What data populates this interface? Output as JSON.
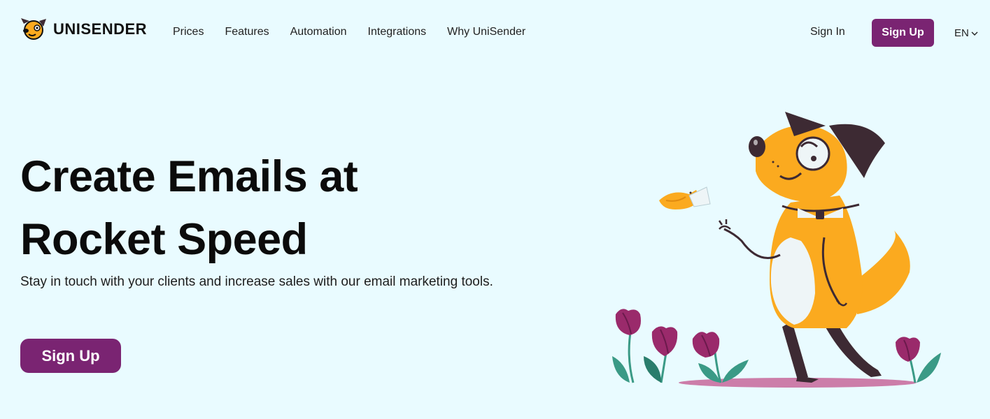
{
  "brand": {
    "name": "UNISENDER"
  },
  "nav": {
    "items": [
      {
        "label": "Prices"
      },
      {
        "label": "Features"
      },
      {
        "label": "Automation"
      },
      {
        "label": "Integrations"
      },
      {
        "label": "Why UniSender"
      }
    ]
  },
  "header": {
    "signin_label": "Sign In",
    "signup_label": "Sign Up",
    "language": "EN"
  },
  "hero": {
    "title_line1": "Create Emails at",
    "title_line2": "Rocket Speed",
    "subtitle": "Stay in touch with your clients and increase sales with our email marketing tools.",
    "cta_label": "Sign Up"
  },
  "colors": {
    "background": "#e9fbff",
    "accent": "#7a2472",
    "dog_orange": "#fbaa1f",
    "dark": "#3d2a33",
    "tulip": "#9a2a6b",
    "leaf": "#3a9a86"
  },
  "icons": {
    "logo": "dog-head-icon",
    "language_chevron": "chevron-down-icon"
  }
}
